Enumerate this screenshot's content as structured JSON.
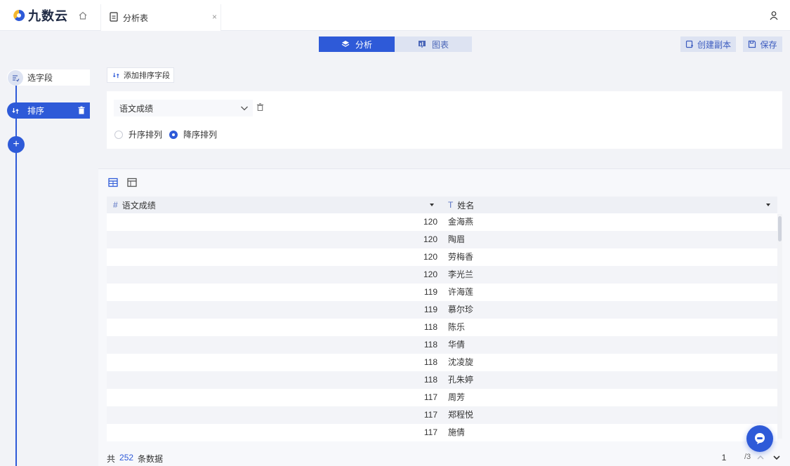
{
  "app": {
    "logo_text": "九数云",
    "brand_color": "#2e5ad8"
  },
  "tab": {
    "label": "分析表",
    "close": "×"
  },
  "toolbar": {
    "analyze_label": "分析",
    "chart_label": "图表",
    "copy_label": "创建副本",
    "save_label": "保存"
  },
  "steps": {
    "select_fields": "选字段",
    "sort": "排序",
    "add": "+"
  },
  "sort_config": {
    "add_sort_field": "添加排序字段",
    "field": "语文成绩",
    "asc_label": "升序排列",
    "desc_label": "降序排列",
    "selected": "desc"
  },
  "table": {
    "columns": [
      {
        "type_icon": "#",
        "name": "语文成绩"
      },
      {
        "type_icon": "T",
        "name": "姓名"
      }
    ],
    "rows": [
      [
        "120",
        "金海燕"
      ],
      [
        "120",
        "陶眉"
      ],
      [
        "120",
        "劳梅香"
      ],
      [
        "120",
        "李光兰"
      ],
      [
        "119",
        "许海莲"
      ],
      [
        "119",
        "慕尔珍"
      ],
      [
        "118",
        "陈乐"
      ],
      [
        "118",
        "华倩"
      ],
      [
        "118",
        "沈凌旋"
      ],
      [
        "118",
        "孔朱婷"
      ],
      [
        "117",
        "周芳"
      ],
      [
        "117",
        "郑程悦"
      ],
      [
        "117",
        "施倩"
      ]
    ]
  },
  "footer": {
    "prefix": "共",
    "total": "252",
    "suffix": "条数据",
    "page": "1",
    "pages": "/3"
  }
}
